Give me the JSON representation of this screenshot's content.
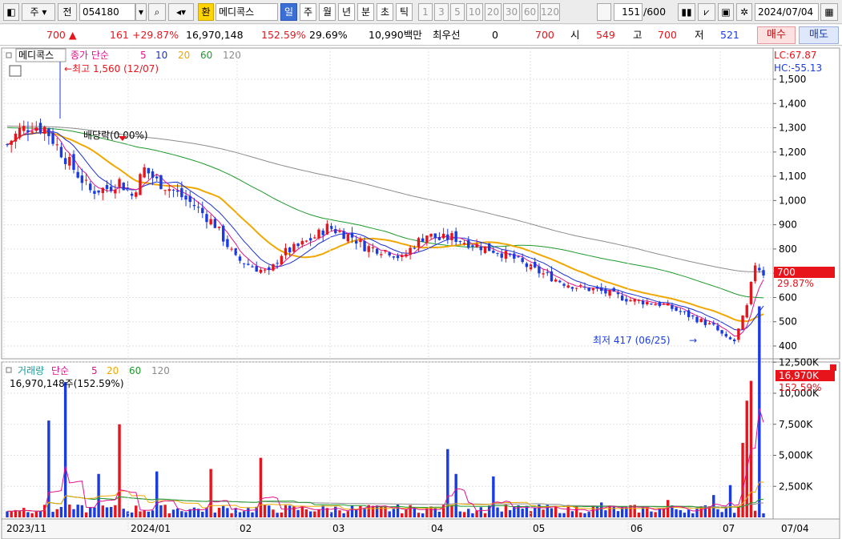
{
  "toolbar": {
    "code_prefix": "주",
    "code_prefix2": "전",
    "code": "054180",
    "currency_btn": "환",
    "stock_name": "메디콕스",
    "periods": [
      "일",
      "주",
      "월",
      "년",
      "분",
      "초",
      "틱"
    ],
    "active_period": "일",
    "numbers": [
      "1",
      "3",
      "5",
      "10",
      "20",
      "30",
      "60",
      "120"
    ],
    "count": "151",
    "count_total": "/600",
    "date": "2024/07/04"
  },
  "info": {
    "price": "700",
    "change": "161",
    "change_pct": "+29.87%",
    "volume": "16,970,148",
    "vol_ratio": "152.59%",
    "turnover": "29.69%",
    "amount": "10,990백만",
    "pref_label": "최우선",
    "pref_val": "0",
    "bid": "700",
    "open_label": "시",
    "open": "549",
    "high_label": "고",
    "high": "700",
    "low_label": "저",
    "low": "521",
    "buy": "매수",
    "sell": "매도"
  },
  "price_panel": {
    "name": "메디콕스",
    "ma_label": "종가 단순",
    "ma_periods": [
      "5",
      "10",
      "20",
      "60",
      "120"
    ],
    "lc": "LC:67.87",
    "hc": "HC:-55.13",
    "high_marker": "최고 1,560 (12/07)",
    "low_marker": "최저 417 (06/25)",
    "dividend": "배당락(0.00%)",
    "last_price": "700",
    "last_pct": "29.87%",
    "yticks": [
      [
        "1,500",
        1500
      ],
      [
        "1,400",
        1400
      ],
      [
        "1,300",
        1300
      ],
      [
        "1,200",
        1200
      ],
      [
        "1,100",
        1100
      ],
      [
        "1,000",
        1000
      ],
      [
        "900",
        900
      ],
      [
        "800",
        800
      ],
      [
        "700",
        700
      ],
      [
        "600",
        600
      ],
      [
        "500",
        500
      ],
      [
        "400",
        400
      ]
    ]
  },
  "volume_panel": {
    "label": "거래량",
    "ma_label": "단순",
    "ma_periods": [
      "5",
      "20",
      "60",
      "120"
    ],
    "summary": "16,970,148주(152.59%)",
    "last": "16,970K",
    "last_pct": "152.59%",
    "yticks": [
      [
        "12,500K",
        12500
      ],
      [
        "10,000K",
        10000
      ],
      [
        "7,500K",
        7500
      ],
      [
        "5,000K",
        5000
      ],
      [
        "2,500K",
        2500
      ]
    ]
  },
  "xaxis": {
    "labels": [
      "2023/11",
      "2024/01",
      "02",
      "03",
      "04",
      "05",
      "06",
      "07",
      "07/04"
    ]
  },
  "colors": {
    "up": "#e8141c",
    "down": "#1a3be0",
    "ma5": "#e0148c",
    "ma10": "#1a2fd6",
    "ma20": "#f0a800",
    "ma60": "#1e9a2c",
    "ma120": "#8c8c8c"
  },
  "chart_data": {
    "type": "candlestick",
    "price_anchors": [
      [
        0,
        1230
      ],
      [
        3,
        1290
      ],
      [
        6,
        1310
      ],
      [
        9,
        1300
      ],
      [
        13,
        1200
      ],
      [
        16,
        1130
      ],
      [
        20,
        1040
      ],
      [
        24,
        1050
      ],
      [
        27,
        1080
      ],
      [
        30,
        1020
      ],
      [
        33,
        1130
      ],
      [
        36,
        1080
      ],
      [
        40,
        1040
      ],
      [
        45,
        980
      ],
      [
        50,
        900
      ],
      [
        55,
        760
      ],
      [
        60,
        720
      ],
      [
        63,
        700
      ],
      [
        66,
        780
      ],
      [
        70,
        810
      ],
      [
        74,
        850
      ],
      [
        77,
        890
      ],
      [
        80,
        870
      ],
      [
        83,
        850
      ],
      [
        86,
        810
      ],
      [
        89,
        800
      ],
      [
        92,
        790
      ],
      [
        95,
        760
      ],
      [
        98,
        820
      ],
      [
        101,
        860
      ],
      [
        104,
        840
      ],
      [
        107,
        850
      ],
      [
        110,
        830
      ],
      [
        114,
        810
      ],
      [
        118,
        790
      ],
      [
        122,
        760
      ],
      [
        126,
        720
      ],
      [
        130,
        690
      ],
      [
        134,
        660
      ],
      [
        138,
        640
      ],
      [
        142,
        630
      ],
      [
        146,
        610
      ],
      [
        150,
        590
      ],
      [
        154,
        580
      ],
      [
        158,
        570
      ],
      [
        162,
        540
      ],
      [
        166,
        510
      ],
      [
        170,
        480
      ],
      [
        173,
        430
      ],
      [
        175,
        420
      ],
      [
        178,
        560
      ],
      [
        180,
        740
      ],
      [
        182,
        700
      ]
    ],
    "vol_spikes": [
      [
        10,
        7800
      ],
      [
        14,
        10900
      ],
      [
        22,
        3500
      ],
      [
        27,
        7500
      ],
      [
        36,
        3700
      ],
      [
        49,
        3900
      ],
      [
        61,
        4800
      ],
      [
        106,
        5500
      ],
      [
        108,
        3500
      ],
      [
        117,
        3300
      ],
      [
        130,
        1000
      ],
      [
        143,
        1200
      ],
      [
        159,
        1400
      ],
      [
        170,
        1800
      ],
      [
        174,
        2600
      ],
      [
        177,
        6000
      ],
      [
        178,
        9400
      ],
      [
        179,
        11000
      ],
      [
        181,
        17000
      ]
    ],
    "vol_base": 800,
    "ranges": {
      "price": [
        350,
        1560
      ],
      "volume": [
        0,
        17000
      ]
    }
  }
}
